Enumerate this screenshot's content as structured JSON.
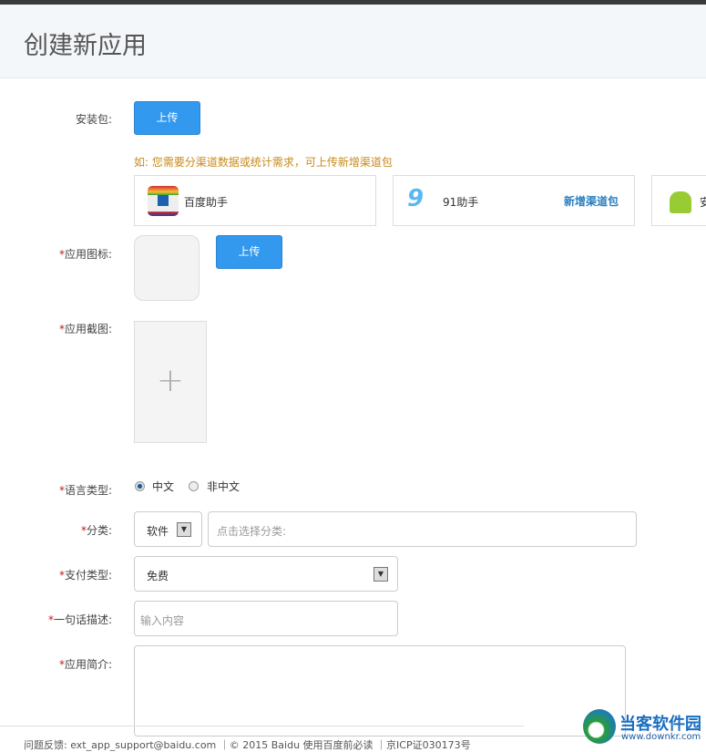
{
  "header": {
    "title": "创建新应用"
  },
  "package": {
    "label": "安装包:",
    "upload": "上传",
    "hint": "如: 您需要分渠道数据或统计需求，可上传新增渠道包",
    "channels": [
      {
        "name": "百度助手"
      },
      {
        "name": "91助手",
        "action": "新增渠道包"
      },
      {
        "name": "安"
      }
    ]
  },
  "icon": {
    "star": "*",
    "label": "应用图标:",
    "upload": "上传"
  },
  "screenshot": {
    "star": "*",
    "label": "应用截图:",
    "add": "+"
  },
  "language": {
    "star": "*",
    "label": "语言类型:",
    "options": [
      "中文",
      "非中文"
    ],
    "selected": "中文"
  },
  "category": {
    "star": "*",
    "label": "分类:",
    "type": "软件",
    "placeholder": "点击选择分类:"
  },
  "payment": {
    "star": "*",
    "label": "支付类型:",
    "value": "免费"
  },
  "summary": {
    "star": "*",
    "label": "一句话描述:",
    "placeholder": "输入内容"
  },
  "intro": {
    "star": "*",
    "label": "应用简介:"
  },
  "footer": {
    "text": "问题反馈: ext_app_support@baidu.com ｜© 2015 Baidu 使用百度前必读 ｜京ICP证030173号"
  },
  "watermark": {
    "title": "当客软件园",
    "url": "www.downkr.com"
  },
  "colors": {
    "accent": "#3399ee",
    "hint": "#c88a1a",
    "star": "#c0151b"
  }
}
